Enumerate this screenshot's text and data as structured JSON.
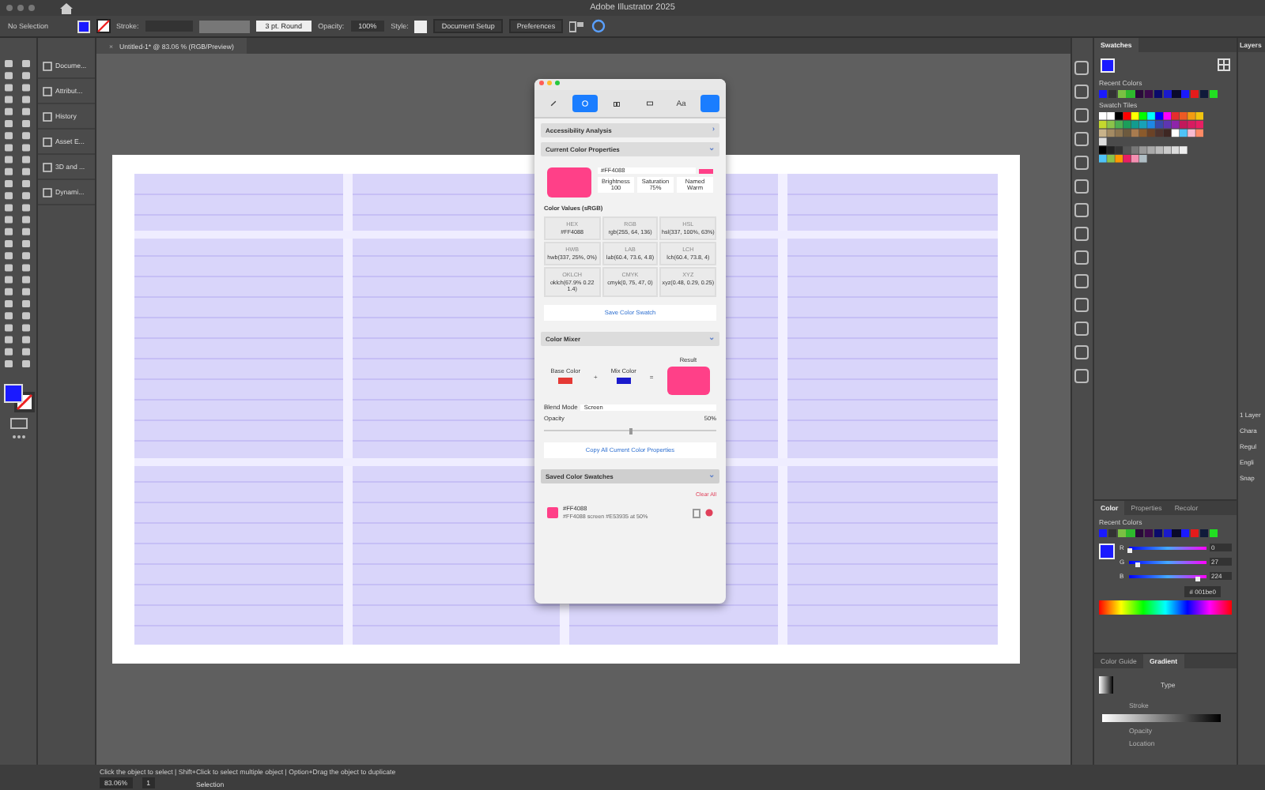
{
  "window": {
    "title": "Adobe Illustrator 2025"
  },
  "control_bar": {
    "selection": "No Selection",
    "stroke_label": "Stroke:",
    "brush": "3 pt. Round",
    "opacity_label": "Opacity:",
    "opacity": "100%",
    "style_label": "Style:",
    "buttons": [
      "Document Setup",
      "Preferences"
    ]
  },
  "left_panels": [
    {
      "label": "Docume..."
    },
    {
      "label": "Attribut..."
    },
    {
      "label": "History"
    },
    {
      "label": "Asset E..."
    },
    {
      "label": "3D and ..."
    },
    {
      "label": "Dynami..."
    }
  ],
  "document_tab": {
    "close": "×",
    "title": "Untitled-1* @ 83.06 % (RGB/Preview)"
  },
  "plugin": {
    "tabs": [
      {
        "kind": "eyedropper",
        "selected": false
      },
      {
        "kind": "palette",
        "selected": true
      },
      {
        "kind": "compare",
        "selected": false
      },
      {
        "kind": "ruler",
        "selected": false
      },
      {
        "kind": "text",
        "label": "Aa",
        "selected": false
      }
    ],
    "pinned": true,
    "accessibility": {
      "title": "Accessibility Analysis",
      "chevron": "›"
    },
    "current": {
      "title": "Current Color Properties",
      "chevron": "⌄",
      "color": "#ff4088",
      "hex": "#FF4088",
      "stats": [
        {
          "label": "Brightness",
          "value": "100"
        },
        {
          "label": "Saturation",
          "value": "75%"
        },
        {
          "label": "Named",
          "value": "Warm"
        }
      ],
      "values_title": "Color Values (sRGB)",
      "values": [
        {
          "label": "HEX",
          "value": "#FF4088"
        },
        {
          "label": "RGB",
          "value": "rgb(255, 64, 136)"
        },
        {
          "label": "HSL",
          "value": "hsl(337, 100%, 63%)"
        },
        {
          "label": "HWB",
          "value": "hwb(337, 25%, 0%)"
        },
        {
          "label": "LAB",
          "value": "lab(60.4, 73.6, 4.8)"
        },
        {
          "label": "LCH",
          "value": "lch(60.4, 73.8, 4)"
        },
        {
          "label": "OKLCH",
          "value": "oklch(67.9% 0.22 1.4)"
        },
        {
          "label": "CMYK",
          "value": "cmyk(0, 75, 47, 0)"
        },
        {
          "label": "XYZ",
          "value": "xyz(0.48, 0.29, 0.25)"
        }
      ],
      "save_button": "Save Color Swatch"
    },
    "mixer": {
      "title": "Color Mixer",
      "chevron": "⌄",
      "base": {
        "label": "Base Color",
        "color": "#e53935"
      },
      "plus": "+",
      "mix": {
        "label": "Mix Color",
        "color": "#1a1acc"
      },
      "equals": "=",
      "result": {
        "label": "Result",
        "color": "#ff4088"
      },
      "blend_label": "Blend Mode",
      "blend_value": "Screen",
      "opacity_label": "Opacity",
      "opacity_value": "50%",
      "level": 0.5,
      "copy_button": "Copy All Current Color Properties"
    },
    "saved": {
      "title": "Saved Color Swatches",
      "chevron": "⌄",
      "clear": "Clear All",
      "items": [
        {
          "color": "#ff4088",
          "name": "#FF4088",
          "description": "#FF4088 screen #E53935 at 50%"
        }
      ]
    }
  },
  "swatches": {
    "title": "Swatches",
    "recent_label": "Recent Colors",
    "recent": [
      {
        "color": "#1a1aff"
      },
      {
        "color": "#333333"
      },
      {
        "color": "#7bc043"
      },
      {
        "color": "#2eb82e"
      },
      {
        "color": "#2a0a3a"
      },
      {
        "color": "#3a0a4a"
      },
      {
        "color": "#0a0a6a"
      },
      {
        "color": "#1a1acc"
      },
      {
        "color": "#0a0a2a"
      },
      {
        "color": "#1a1aff"
      },
      {
        "color": "#e51b1b"
      },
      {
        "color": "#101a3a"
      },
      {
        "color": "#22dd22"
      }
    ],
    "tiles_label": "Swatch Tiles"
  },
  "layers_tab": {
    "title": "Layers",
    "count": "1 Layer"
  },
  "character_cut": [
    "Chara",
    "Regul",
    "Engli",
    "Snap"
  ],
  "color_panel": {
    "tabs": [
      {
        "label": "Color",
        "selected": true
      },
      {
        "label": "Properties",
        "selected": false
      },
      {
        "label": "Recolor",
        "selected": false
      }
    ],
    "recent_label": "Recent Colors",
    "recent": [
      {
        "color": "#1a1aff"
      },
      {
        "color": "#333333"
      },
      {
        "color": "#7bc043"
      },
      {
        "color": "#2eb82e"
      },
      {
        "color": "#2a0a3a"
      },
      {
        "color": "#3a0a4a"
      },
      {
        "color": "#0a0a6a"
      },
      {
        "color": "#1a1acc"
      },
      {
        "color": "#0a0a2a"
      },
      {
        "color": "#1a1aff"
      },
      {
        "color": "#e51b1b"
      },
      {
        "color": "#101a3a"
      },
      {
        "color": "#22dd22"
      }
    ],
    "sliders": [
      {
        "label": "R",
        "level": 0,
        "value": "0"
      },
      {
        "label": "G",
        "level": 0.11,
        "value": "27"
      },
      {
        "label": "B",
        "level": 0.88,
        "value": "224"
      }
    ],
    "hex_label": "#",
    "hex": "001be0"
  },
  "gradient_panel": {
    "tabs": [
      {
        "label": "Color Guide",
        "selected": false
      },
      {
        "label": "Gradient",
        "selected": true
      }
    ],
    "type_label": "Type",
    "stroke_label": "Stroke",
    "opacity_label": "Opacity",
    "location_label": "Location"
  },
  "status_bar": {
    "zoom": "83.06%",
    "page": "1",
    "tool": "Selection",
    "hint": "Click the object to select  |  Shift+Click to select multiple object  |  Option+Drag the object to duplicate"
  }
}
